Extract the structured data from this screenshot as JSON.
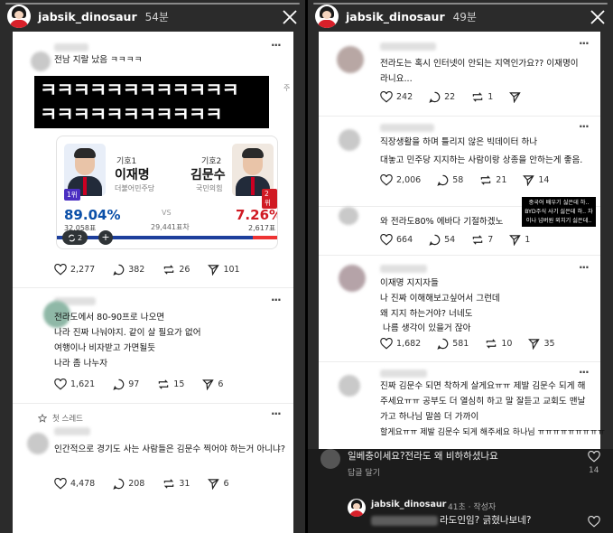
{
  "left_story": {
    "username": "jabsik_dinosaur",
    "time": "54분",
    "post1": {
      "text": "전남 지랄 났음 ㅋㅋㅋㅋ",
      "image_text": [
        "ㅋㅋㅋㅋㅋㅋㅋㅋㅋㅋㅋㅋ",
        "ㅋㅋㅋㅋㅋㅋㅋㅋㅋㅋㅋ"
      ],
      "election": {
        "candidate1": {
          "number": "기호1",
          "name": "이재명",
          "party": "더불어민주당",
          "rank": "1위",
          "percent": "89.04%",
          "votes": "32,058표",
          "share": 0.8904
        },
        "candidate2": {
          "number": "기호2",
          "name": "김문수",
          "party": "국민의힘",
          "rank": "2위",
          "percent": "7.26%",
          "votes": "2,617표"
        },
        "vs": "VS",
        "gap": "29,441표차",
        "pill_count": "2"
      },
      "actions": {
        "likes": "2,277",
        "comments": "382",
        "reposts": "26",
        "shares": "101"
      }
    },
    "post2": {
      "lines": [
        "전라도에서 80-90프로 나오면",
        "나라 진짜 나눠야지. 같이 살 필요가 없어",
        "여행이나 비자받고 가면될듯",
        "나라 좀 나누자"
      ],
      "actions": {
        "likes": "1,621",
        "comments": "97",
        "reposts": "15",
        "shares": "6"
      }
    },
    "thread_label": "첫 스레드",
    "post3": {
      "text": "인간적으로 경기도 사는 사람들은 김문수 찍어야 하는거 아니냐?",
      "actions": {
        "likes": "4,478",
        "comments": "208",
        "reposts": "31",
        "shares": "6"
      }
    }
  },
  "right_story": {
    "username": "jabsik_dinosaur",
    "time": "49분",
    "post1": {
      "text": "전라도는 혹시 인터넷이 안되는 지역인가요?? 이재명이라니요...",
      "actions": {
        "likes": "242",
        "comments": "22",
        "reposts": "1",
        "shares": ""
      }
    },
    "post2": {
      "lines": [
        "직장생활을 하며 틀리지 않은 빅데이터 하나",
        "대놓고 민주당 지지하는 사람이랑 상종을 안하는게 좋음."
      ],
      "actions": {
        "likes": "2,006",
        "comments": "58",
        "reposts": "21",
        "shares": "14"
      }
    },
    "post3": {
      "text": "와 전라도80% 에바다 기절하겠노",
      "sticker": "중국어 배우기 싫은데 하.. BYD주식 사기 싫은데 하.. 차이나 넘버원 외치기 싫은데..",
      "actions": {
        "likes": "664",
        "comments": "54",
        "reposts": "7",
        "shares": "1"
      }
    },
    "post4": {
      "lines": [
        "이재명 지지자들",
        "나 진짜 이해해보고싶어서 그런데",
        "왜 지지 하는거야? 너네도",
        " 나름 생각이 있을거 잖아"
      ],
      "actions": {
        "likes": "1,682",
        "comments": "581",
        "reposts": "10",
        "shares": "35"
      }
    },
    "post5": {
      "text": "진짜 김문수 되면 착하게 살게요ㅠㅠ 제발 김문수 되게 해주세요ㅠㅠ 공부도 더 열심히 하고 말 잘듣고 교회도 맨날 가고 하나님 말씀 더 가까이",
      "last_line": "할게요ㅠㅠ 제발 김문수 되게 해주세요 하나님 ㅠㅠㅠㅠㅠㅠㅠㅠㅠ"
    },
    "overlay": {
      "comment": "일베충이세요?전라도 왜 비하하셨나요",
      "reply_label": "답글 달기",
      "like_count": "14",
      "reply_user": "jabsik_dinosaur",
      "reply_meta": "41초 · 작성자",
      "reply_text": "라도인임? 긁혔나보네?"
    }
  },
  "colors": {
    "blue": "#0a4fa8",
    "red": "#d01a23",
    "bar_blue": "#1d3f9c"
  }
}
